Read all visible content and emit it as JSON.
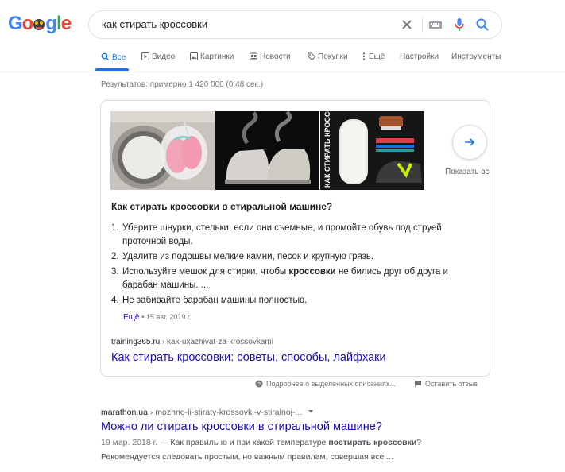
{
  "logo": {
    "letters": [
      "G",
      "o",
      "o",
      "g",
      "l",
      "e"
    ],
    "colors": [
      "#4285f4",
      "#ea4335",
      "#fbbc05",
      "#4285f4",
      "#34a853",
      "#ea4335"
    ]
  },
  "search": {
    "query": "как стирать кроссовки",
    "clear_icon": "close-icon",
    "keyboard_icon": "keyboard-icon",
    "mic_icon": "mic-icon",
    "search_icon": "search-icon"
  },
  "tabs": [
    {
      "label": "Все",
      "icon": "search-icon",
      "active": true
    },
    {
      "label": "Видео",
      "icon": "video-icon"
    },
    {
      "label": "Картинки",
      "icon": "image-icon"
    },
    {
      "label": "Новости",
      "icon": "news-icon"
    },
    {
      "label": "Покупки",
      "icon": "tag-icon"
    },
    {
      "label": "Ещё",
      "icon": "more-vert-icon"
    },
    {
      "label": "Настройки"
    },
    {
      "label": "Инструменты"
    }
  ],
  "result_stats": "Результатов: примерно 1 420 000 (0,48 сек.)",
  "featured": {
    "images": [
      {
        "icon": "washing-machine-sneakers-image"
      },
      {
        "icon": "steaming-sneakers-image"
      },
      {
        "caption": "КАК СТИРАТЬ КРОССОВКИ"
      }
    ],
    "show_all": "Показать все",
    "question": "Как стирать кроссовки в стиральной машине?",
    "steps": [
      {
        "num": "1.",
        "text": "Уберите шнурки, стельки, если они съемные, и промойте обувь под струей проточной воды."
      },
      {
        "num": "2.",
        "text": "Удалите из подошвы мелкие камни, песок и крупную грязь."
      },
      {
        "num": "3.",
        "pre": "Используйте мешок для стирки, чтобы ",
        "bold": "кроссовки",
        "post": " не бились друг об друга и барабан машины. ..."
      },
      {
        "num": "4.",
        "text": "Не забивайте барабан машины полностью."
      }
    ],
    "more_label": "Ещё",
    "more_date": "15 авг. 2019 г.",
    "source_domain": "training365.ru",
    "source_path": " › kak-uxazhivat-za-krossovkami",
    "source_title": "Как стирать кроссовки: советы, способы, лайфхаки"
  },
  "feedback": {
    "about": "Подробнее о выделенных описаниях...",
    "report": "Оставить отзыв"
  },
  "result2": {
    "domain": "marathon.ua",
    "path": " › mozhno-li-stiraty-krossovki-v-stiralnoj-...",
    "title": "Можно ли стирать кроссовки в стиральной машине?",
    "date": "19 мар. 2018 г.",
    "line1_pre": " — Как правильно и при какой температуре ",
    "line1_bold": "постирать кроссовки",
    "line1_post": "?",
    "line2": "Рекомендуется следовать простым, но важным правилам, совершая все ..."
  }
}
